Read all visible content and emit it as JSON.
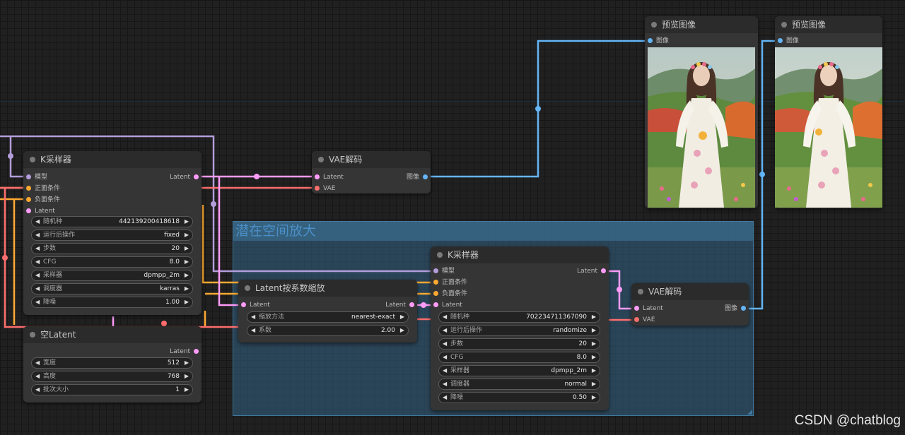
{
  "groups": [
    {
      "title": "潜在空间放大"
    }
  ],
  "nodes": {
    "ksampler1": {
      "title": "K采样器",
      "inputs": [
        "模型",
        "正面条件",
        "负面条件",
        "Latent"
      ],
      "output": "Latent",
      "widgets": [
        {
          "label": "随机种",
          "value": "442139200418618"
        },
        {
          "label": "运行后操作",
          "value": "fixed"
        },
        {
          "label": "步数",
          "value": "20"
        },
        {
          "label": "CFG",
          "value": "8.0"
        },
        {
          "label": "采样器",
          "value": "dpmpp_2m"
        },
        {
          "label": "调度器",
          "value": "karras"
        },
        {
          "label": "降噪",
          "value": "1.00"
        }
      ]
    },
    "vaedecode1": {
      "title": "VAE解码",
      "inputs": [
        "Latent",
        "VAE"
      ],
      "output": "图像"
    },
    "empty_latent": {
      "title": "空Latent",
      "output": "Latent",
      "widgets": [
        {
          "label": "宽度",
          "value": "512"
        },
        {
          "label": "高度",
          "value": "768"
        },
        {
          "label": "批次大小",
          "value": "1"
        }
      ]
    },
    "latent_upscale": {
      "title": "Latent按系数缩放",
      "input": "Latent",
      "output": "Latent",
      "widgets": [
        {
          "label": "缩放方法",
          "value": "nearest-exact"
        },
        {
          "label": "系数",
          "value": "2.00"
        }
      ]
    },
    "ksampler2": {
      "title": "K采样器",
      "inputs": [
        "模型",
        "正面条件",
        "负面条件",
        "Latent"
      ],
      "output": "Latent",
      "widgets": [
        {
          "label": "随机种",
          "value": "702234711367090"
        },
        {
          "label": "运行后操作",
          "value": "randomize"
        },
        {
          "label": "步数",
          "value": "20"
        },
        {
          "label": "CFG",
          "value": "8.0"
        },
        {
          "label": "采样器",
          "value": "dpmpp_2m"
        },
        {
          "label": "调度器",
          "value": "normal"
        },
        {
          "label": "降噪",
          "value": "0.50"
        }
      ]
    },
    "vaedecode2": {
      "title": "VAE解码",
      "inputs": [
        "Latent",
        "VAE"
      ],
      "output": "图像"
    },
    "preview1": {
      "title": "预览图像",
      "input": "图像"
    },
    "preview2": {
      "title": "预览图像",
      "input": "图像"
    }
  },
  "icons": {
    "decrement": "left-arrow-icon",
    "increment": "right-arrow-icon"
  },
  "colors": {
    "model": "#b39ddb",
    "conditioning": "#ffa931",
    "latent": "#ff9cf9",
    "image": "#64b5f6",
    "vae": "#ff6e6e",
    "group": "#3f789e"
  },
  "watermark": "CSDN @chatblog"
}
